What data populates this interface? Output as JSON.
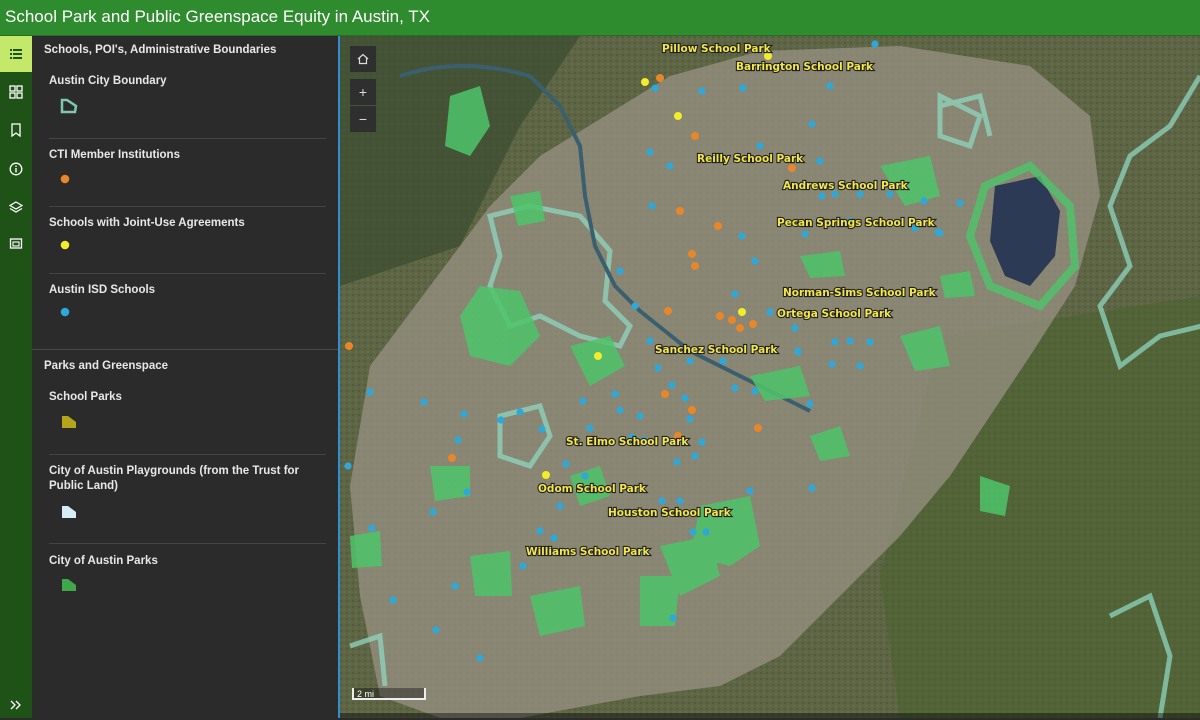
{
  "app": {
    "title": "School Park and Public Greenspace Equity in Austin, TX"
  },
  "rail": {
    "items": [
      {
        "name": "legend",
        "icon": "list-icon",
        "active": true
      },
      {
        "name": "basemap",
        "icon": "grid-icon",
        "active": false
      },
      {
        "name": "bookmarks",
        "icon": "bookmark-icon",
        "active": false
      },
      {
        "name": "about",
        "icon": "info-icon",
        "active": false
      },
      {
        "name": "layers",
        "icon": "layers-icon",
        "active": false
      },
      {
        "name": "print",
        "icon": "print-icon",
        "active": false
      }
    ],
    "expand_icon": "double-chevron-right-icon"
  },
  "legend": {
    "group1": {
      "title": "Schools, POI's, Administrative Boundaries",
      "layers": [
        {
          "label": "Austin City Boundary",
          "symbol": "polygon-outline",
          "color": "#7fc8b0"
        },
        {
          "label": "CTI Member Institutions",
          "symbol": "point",
          "color": "#e8862a"
        },
        {
          "label": "Schools with Joint-Use Agreements",
          "symbol": "point",
          "color": "#f2ec2a"
        },
        {
          "label": "Austin ISD Schools",
          "symbol": "point",
          "color": "#2ea8d8"
        }
      ]
    },
    "group2": {
      "title": "Parks and Greenspace",
      "layers": [
        {
          "label": "School Parks",
          "symbol": "polygon",
          "color": "#b4a51c"
        },
        {
          "label": "City of Austin Playgrounds (from the Trust for Public Land)",
          "symbol": "polygon",
          "color": "#d8ecf8"
        },
        {
          "label": "City of Austin Parks",
          "symbol": "polygon",
          "color": "#3ea84a"
        }
      ]
    }
  },
  "map": {
    "home_icon": "home-icon",
    "zoom_in": "+",
    "zoom_out": "−",
    "scale_label": "2 mi",
    "school_park_labels": [
      "Pillow School Park",
      "Barrington School Park",
      "Reilly School Park",
      "Andrews School Park",
      "Pecan Springs School Park",
      "Norman-Sims School Park",
      "Ortega School Park",
      "Sanchez School Park",
      "St. Elmo School Park",
      "Odom School Park",
      "Houston School Park",
      "Williams School Park"
    ],
    "colors": {
      "city_boundary": "#8fd6bf",
      "parks": "#4ec46a",
      "cti": "#e8862a",
      "joint_use": "#f2ec2a",
      "aisd": "#2ea8d8",
      "river": "#3a5f6f"
    }
  }
}
